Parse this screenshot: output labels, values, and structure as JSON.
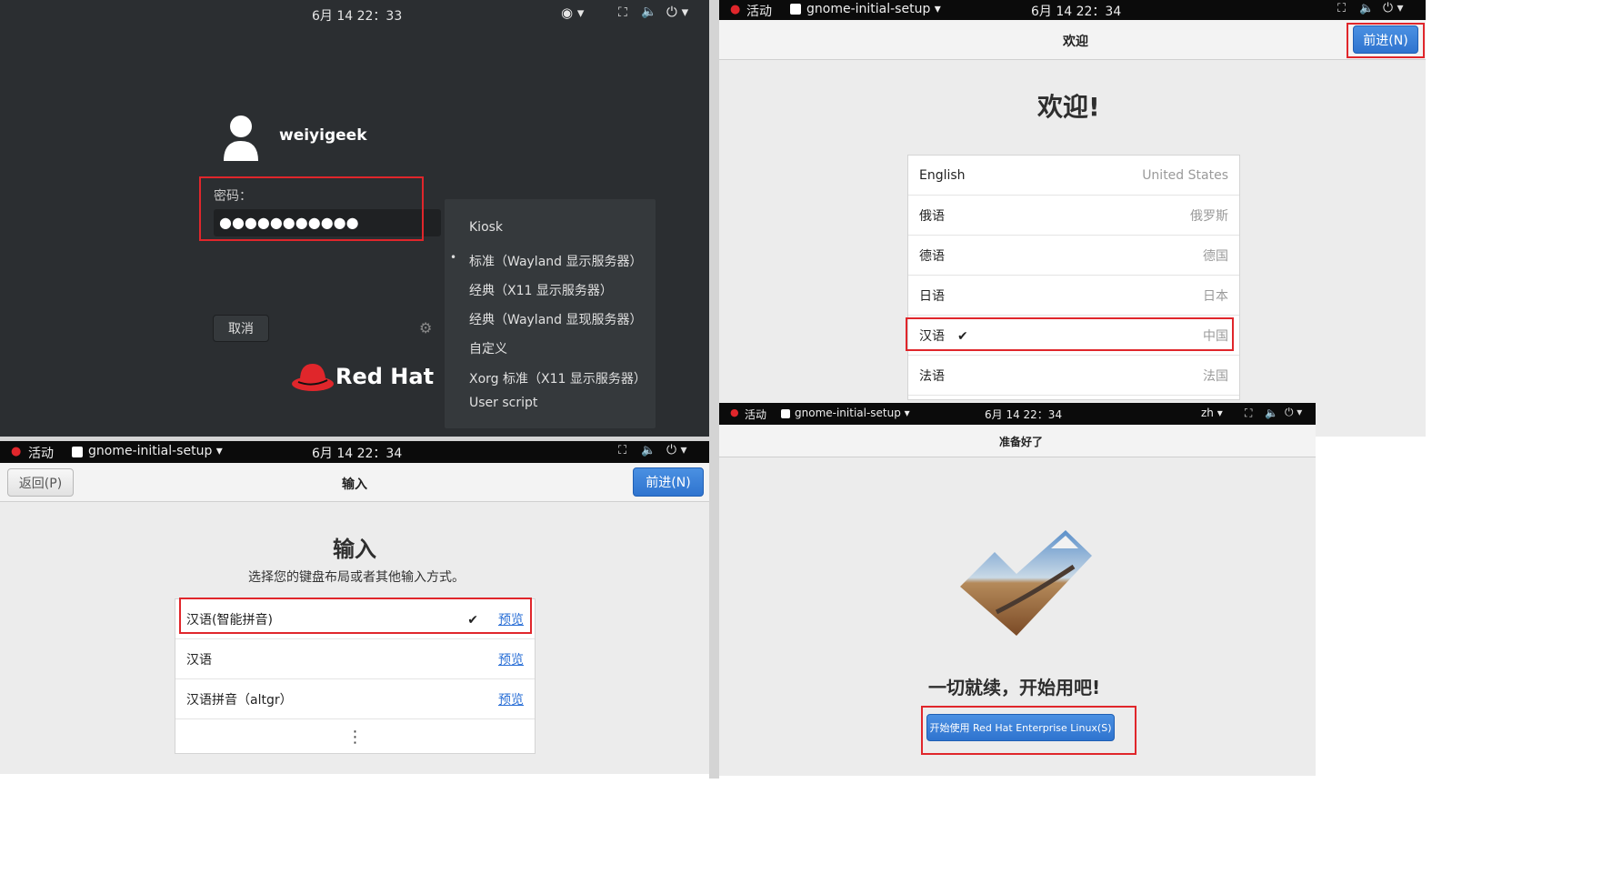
{
  "login": {
    "time": "6月 14 22：33",
    "username": "weiyigeek",
    "password_label": "密码：",
    "password_dots": "●●●●●●●●●●●",
    "cancel": "取消",
    "brand": "Red Hat",
    "sessions": [
      {
        "label": "Kiosk",
        "selected": false
      },
      {
        "label": "标准（Wayland 显示服务器）",
        "selected": true
      },
      {
        "label": "经典（X11 显示服务器）",
        "selected": false
      },
      {
        "label": "经典（Wayland 显现服务器）",
        "selected": false
      },
      {
        "label": "自定义",
        "selected": false
      },
      {
        "label": "Xorg 标准（X11 显示服务器）",
        "selected": false
      },
      {
        "label": "User script",
        "selected": false
      }
    ],
    "bullet": "•"
  },
  "topbar": {
    "activities": "活动",
    "app": "gnome-initial-setup ▾"
  },
  "welcome": {
    "time": "6月 14 22：34",
    "header": "欢迎",
    "next": "前进(N)",
    "heading": "欢迎!",
    "languages": [
      {
        "name": "English",
        "region": "United States",
        "check": ""
      },
      {
        "name": "俄语",
        "region": "俄罗斯",
        "check": ""
      },
      {
        "name": "德语",
        "region": "德国",
        "check": ""
      },
      {
        "name": "日语",
        "region": "日本",
        "check": ""
      },
      {
        "name": "汉语",
        "region": "中国",
        "check": "✔"
      },
      {
        "name": "法语",
        "region": "法国",
        "check": ""
      }
    ]
  },
  "input": {
    "time": "6月 14 22：34",
    "back": "返回(P)",
    "header": "输入",
    "next": "前进(N)",
    "heading": "输入",
    "subtitle": "选择您的键盘布局或者其他输入方式。",
    "methods": [
      {
        "name": "汉语(智能拼音)",
        "check": "✔",
        "preview": "预览"
      },
      {
        "name": "汉语",
        "check": "",
        "preview": "预览"
      },
      {
        "name": "汉语拼音（altgr）",
        "check": "",
        "preview": "预览"
      }
    ],
    "more": "⋮"
  },
  "ready": {
    "time": "6月 14 22：34",
    "lang": "zh ▾",
    "header": "准备好了",
    "heading": "一切就续，开始用吧!",
    "start": "开始使用 Red Hat Enterprise Linux(S)"
  }
}
